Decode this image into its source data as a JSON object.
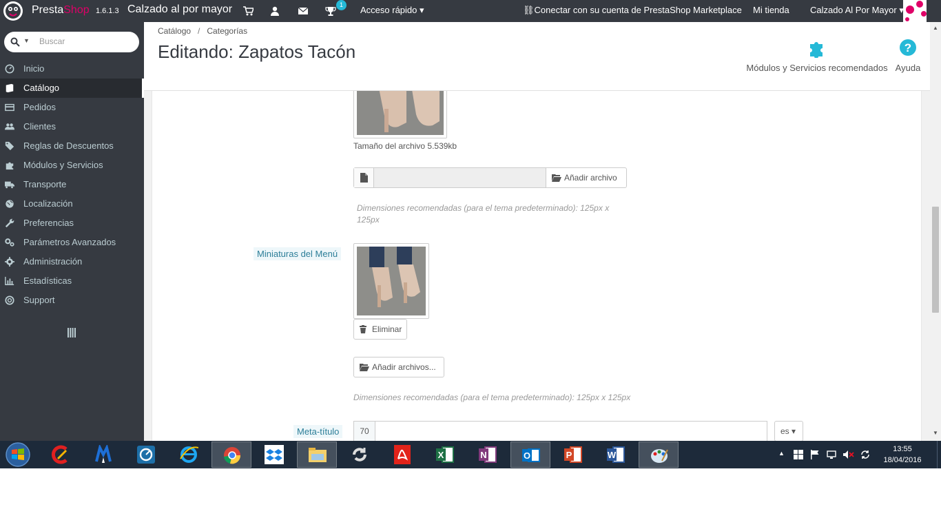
{
  "topbar": {
    "brand_a": "Presta",
    "brand_b": "Shop",
    "version": "1.6.1.3",
    "shop_name": "Calzado al por mayor",
    "notification_count": "1",
    "quick_access": "Acceso rápido",
    "connect": "Conectar con su cuenta de PrestaShop Marketplace",
    "my_shop": "Mi tienda",
    "shop_selector": "Calzado Al Por Mayor"
  },
  "sidebar": {
    "search_placeholder": "Buscar",
    "items": [
      {
        "label": "Inicio",
        "icon": "dashboard-icon"
      },
      {
        "label": "Catálogo",
        "icon": "book-icon"
      },
      {
        "label": "Pedidos",
        "icon": "credit-card-icon"
      },
      {
        "label": "Clientes",
        "icon": "users-icon"
      },
      {
        "label": "Reglas de Descuentos",
        "icon": "tags-icon"
      },
      {
        "label": "Módulos y Servicios",
        "icon": "puzzle-icon"
      },
      {
        "label": "Transporte",
        "icon": "truck-icon"
      },
      {
        "label": "Localización",
        "icon": "globe-icon"
      },
      {
        "label": "Preferencias",
        "icon": "wrench-icon"
      },
      {
        "label": "Parámetros Avanzados",
        "icon": "cogs-icon"
      },
      {
        "label": "Administración",
        "icon": "cog-icon"
      },
      {
        "label": "Estadísticas",
        "icon": "bar-chart-icon"
      },
      {
        "label": "Support",
        "icon": "life-ring-icon"
      }
    ],
    "active_index": 1
  },
  "header": {
    "breadcrumb": [
      "Catálogo",
      "Categorías"
    ],
    "title": "Editando: Zapatos Tacón",
    "modules_label": "Módulos y Servicios recomendados",
    "help_label": "Ayuda"
  },
  "form": {
    "file_size": "Tamaño del archivo 5.539kb",
    "add_file": "Añadir archivo",
    "hint_dimensions_1": "Dimensiones recomendadas (para el tema predeterminado): 125px x 125px",
    "menu_thumbs_label": "Miniaturas del Menú",
    "delete": "Eliminar",
    "add_files": "Añadir archivos...",
    "hint_dimensions_2": "Dimensiones recomendadas (para el tema predeterminado): 125px x 125px",
    "meta_title_label": "Meta-título",
    "meta_title_counter": "70",
    "language": "es"
  },
  "taskbar": {
    "apps": [
      "start",
      "ccleaner",
      "malwarebytes",
      "app-circle",
      "internet-explorer",
      "chrome",
      "dropbox",
      "file-explorer",
      "sync",
      "acrobat",
      "excel",
      "onenote",
      "outlook",
      "powerpoint",
      "word",
      "paint"
    ],
    "time": "13:55",
    "date": "18/04/2016"
  },
  "colors": {
    "topbar": "#363a41",
    "sidebar": "#363a41",
    "accent": "#25b9d7",
    "brand_pink": "#df0067",
    "taskbar": "#1d2a3a"
  }
}
